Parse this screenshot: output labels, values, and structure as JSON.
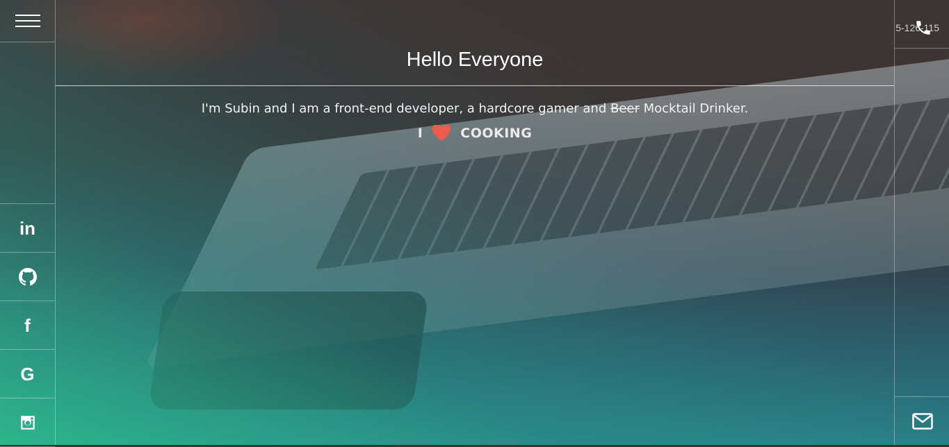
{
  "header": {
    "title": "Hello Everyone"
  },
  "intro": {
    "before": "I'm Subin and I am a front-end developer, a hardcore gamer and ",
    "struck": "Beer",
    "after": " Mocktail Drinker."
  },
  "love": {
    "prefix": "I",
    "icon": "heart-icon",
    "word": "COOKING",
    "heart_color": "#ef5b4a"
  },
  "left_sidebar": {
    "menu_icon": "hamburger-menu-icon",
    "social": [
      {
        "name": "linkedin-icon",
        "glyph": "in"
      },
      {
        "name": "github-icon",
        "glyph": ""
      },
      {
        "name": "facebook-icon",
        "glyph": "f"
      },
      {
        "name": "google-icon",
        "glyph": "G"
      },
      {
        "name": "instagram-icon",
        "glyph": ""
      }
    ]
  },
  "right_sidebar": {
    "phone_number": "5-126-115",
    "phone_icon": "phone-icon",
    "mail_icon": "mail-icon"
  }
}
